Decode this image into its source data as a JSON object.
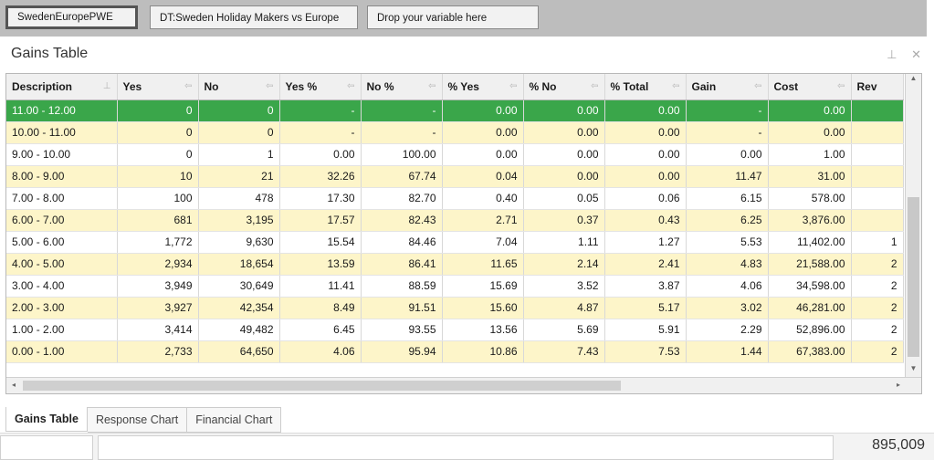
{
  "variables": {
    "chip1": "SwedenEuropePWE",
    "chip2": "DT:Sweden Holiday Makers vs Europe",
    "chip3": "Drop your variable here"
  },
  "panel": {
    "title": "Gains Table",
    "pin_icon": "pin-icon",
    "close_icon": "close-icon"
  },
  "grid": {
    "columns": [
      "Description",
      "Yes",
      "No",
      "Yes %",
      "No %",
      "% Yes",
      "% No",
      "% Total",
      "Gain",
      "Cost",
      "Rev"
    ],
    "rows": [
      [
        "11.00 - 12.00",
        "0",
        "0",
        "-",
        "-",
        "0.00",
        "0.00",
        "0.00",
        "-",
        "0.00",
        ""
      ],
      [
        "10.00 - 11.00",
        "0",
        "0",
        "-",
        "-",
        "0.00",
        "0.00",
        "0.00",
        "-",
        "0.00",
        ""
      ],
      [
        "9.00 - 10.00",
        "0",
        "1",
        "0.00",
        "100.00",
        "0.00",
        "0.00",
        "0.00",
        "0.00",
        "1.00",
        ""
      ],
      [
        "8.00 - 9.00",
        "10",
        "21",
        "32.26",
        "67.74",
        "0.04",
        "0.00",
        "0.00",
        "11.47",
        "31.00",
        ""
      ],
      [
        "7.00 - 8.00",
        "100",
        "478",
        "17.30",
        "82.70",
        "0.40",
        "0.05",
        "0.06",
        "6.15",
        "578.00",
        ""
      ],
      [
        "6.00 - 7.00",
        "681",
        "3,195",
        "17.57",
        "82.43",
        "2.71",
        "0.37",
        "0.43",
        "6.25",
        "3,876.00",
        ""
      ],
      [
        "5.00 - 6.00",
        "1,772",
        "9,630",
        "15.54",
        "84.46",
        "7.04",
        "1.11",
        "1.27",
        "5.53",
        "11,402.00",
        "1"
      ],
      [
        "4.00 - 5.00",
        "2,934",
        "18,654",
        "13.59",
        "86.41",
        "11.65",
        "2.14",
        "2.41",
        "4.83",
        "21,588.00",
        "2"
      ],
      [
        "3.00 - 4.00",
        "3,949",
        "30,649",
        "11.41",
        "88.59",
        "15.69",
        "3.52",
        "3.87",
        "4.06",
        "34,598.00",
        "2"
      ],
      [
        "2.00 - 3.00",
        "3,927",
        "42,354",
        "8.49",
        "91.51",
        "15.60",
        "4.87",
        "5.17",
        "3.02",
        "46,281.00",
        "2"
      ],
      [
        "1.00 - 2.00",
        "3,414",
        "49,482",
        "6.45",
        "93.55",
        "13.56",
        "5.69",
        "5.91",
        "2.29",
        "52,896.00",
        "2"
      ],
      [
        "0.00 - 1.00",
        "2,733",
        "64,650",
        "4.06",
        "95.94",
        "10.86",
        "7.43",
        "7.53",
        "1.44",
        "67,383.00",
        "2"
      ]
    ]
  },
  "tabs": [
    "Gains Table",
    "Response Chart",
    "Financial Chart"
  ],
  "status": {
    "total": "895,009"
  },
  "colors": {
    "selected_row": "#3aa64a",
    "alt_row": "#fdf5c9"
  }
}
